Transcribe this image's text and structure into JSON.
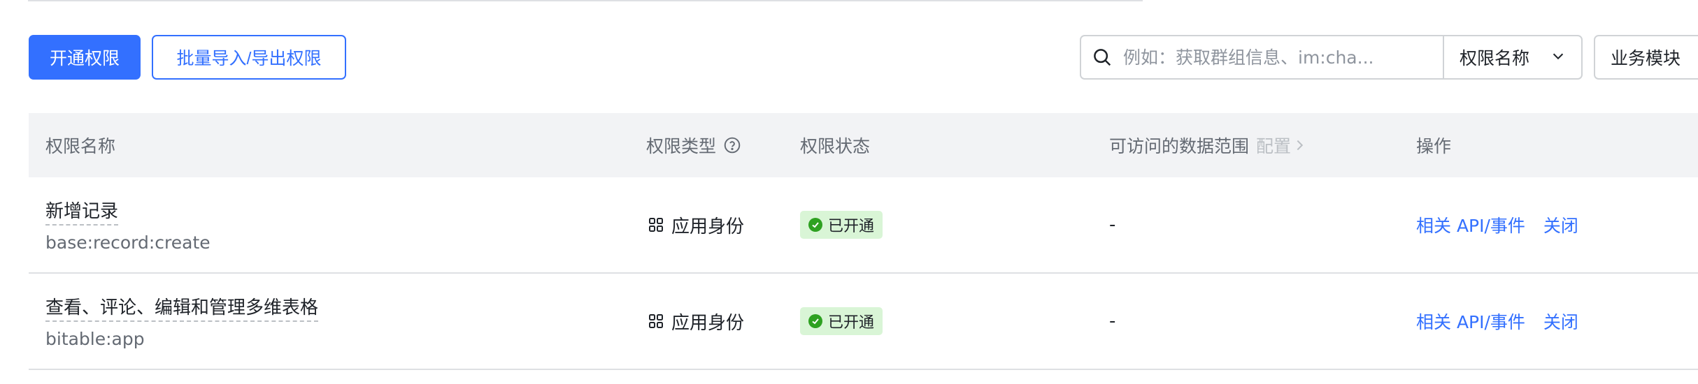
{
  "toolbar": {
    "enable_button": "开通权限",
    "batch_button": "批量导入/导出权限",
    "search_placeholder": "例如：获取群组信息、im:cha...",
    "search_field_select": "权限名称",
    "module_select": "业务模块"
  },
  "table": {
    "headers": {
      "name": "权限名称",
      "type": "权限类型",
      "status": "权限状态",
      "scope": "可访问的数据范围",
      "scope_config": "配置",
      "actions": "操作"
    },
    "rows": [
      {
        "title": "新增记录",
        "code": "base:record:create",
        "type": "应用身份",
        "status": "已开通",
        "scope": "-",
        "action_related": "相关 API/事件",
        "action_close": "关闭"
      },
      {
        "title": "查看、评论、编辑和管理多维表格",
        "code": "bitable:app",
        "type": "应用身份",
        "status": "已开通",
        "scope": "-",
        "action_related": "相关 API/事件",
        "action_close": "关闭"
      }
    ]
  },
  "colors": {
    "primary": "#3370ff",
    "status_green": "#2ea121",
    "status_bg": "#d9f5d6",
    "header_bg": "#f2f3f5"
  },
  "icons": [
    "search-icon",
    "chevron-down-icon",
    "help-circle-icon",
    "chevron-right-icon",
    "app-grid-icon",
    "check-circle-icon"
  ]
}
